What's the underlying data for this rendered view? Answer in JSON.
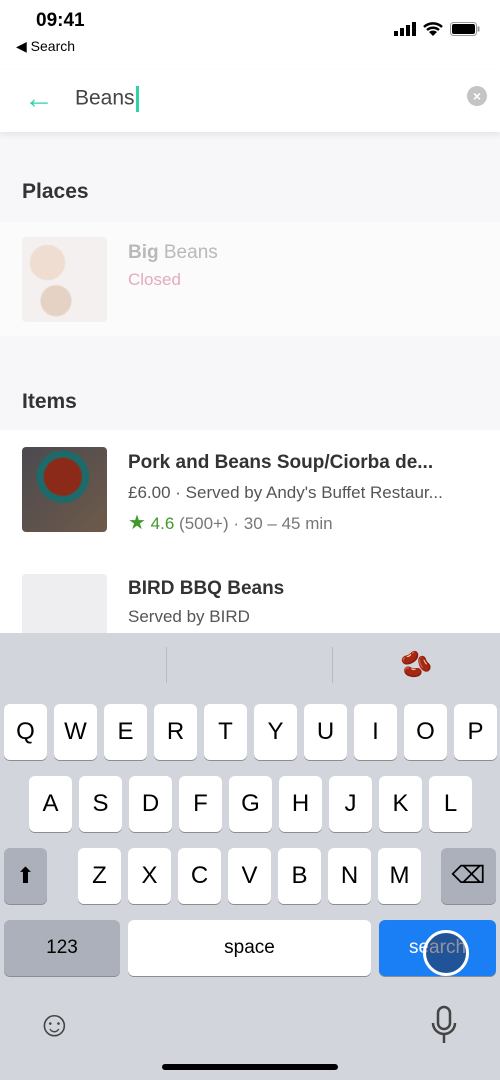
{
  "status": {
    "time": "09:41",
    "back_app": "◀ Search"
  },
  "search": {
    "query": "Beans",
    "back_icon": "arrow-left-icon",
    "clear_icon": "clear-icon"
  },
  "places": {
    "heading": "Places",
    "items": [
      {
        "name_bold": "Big",
        "name_rest": " Beans",
        "status": "Closed"
      }
    ]
  },
  "items": {
    "heading": "Items",
    "list": [
      {
        "title": "Pork and Beans Soup/Ciorba de...",
        "price": "£6.00",
        "served": " · Served by Andy's Buffet Restaur...",
        "rating": "4.6",
        "count": " (500+)",
        "time": " · 30 – 45 min"
      },
      {
        "title": "BIRD BBQ Beans",
        "served": "Served by BIRD"
      }
    ]
  },
  "keyboard": {
    "suggestion_emoji": "🫘",
    "rows": [
      [
        "Q",
        "W",
        "E",
        "R",
        "T",
        "Y",
        "U",
        "I",
        "O",
        "P"
      ],
      [
        "A",
        "S",
        "D",
        "F",
        "G",
        "H",
        "J",
        "K",
        "L"
      ],
      [
        "Z",
        "X",
        "C",
        "V",
        "B",
        "N",
        "M"
      ]
    ],
    "numbers": "123",
    "space": "space",
    "search": "search",
    "shift": "⬆",
    "backspace": "⌫",
    "emoji_icon": "☺",
    "mic_icon": "🎙"
  },
  "colors": {
    "accent": "#2ed3a8",
    "closed": "#e8a0b0",
    "rating": "#3f9a2a",
    "search_key": "#1a7ef5"
  }
}
